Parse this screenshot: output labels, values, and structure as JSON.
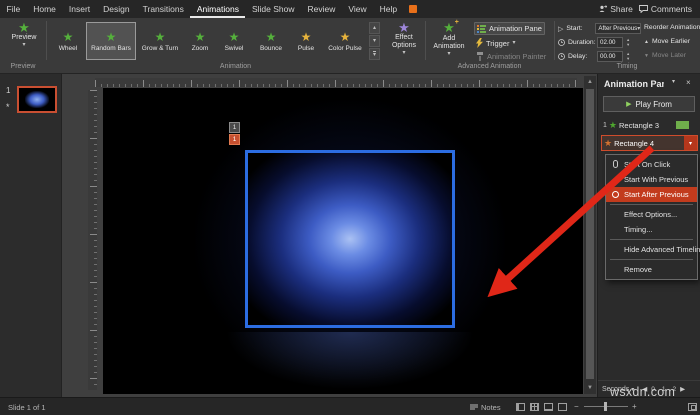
{
  "menubar": {
    "items": [
      {
        "label": "File"
      },
      {
        "label": "Home"
      },
      {
        "label": "Insert"
      },
      {
        "label": "Design"
      },
      {
        "label": "Transitions"
      },
      {
        "label": "Animations"
      },
      {
        "label": "Slide Show"
      },
      {
        "label": "Review"
      },
      {
        "label": "View"
      },
      {
        "label": "Help"
      }
    ],
    "share_label": "Share",
    "comments_label": "Comments"
  },
  "ribbon": {
    "preview_label": "Preview",
    "gallery": [
      {
        "label": "Wheel"
      },
      {
        "label": "Random Bars"
      },
      {
        "label": "Grow & Turn"
      },
      {
        "label": "Zoom"
      },
      {
        "label": "Swivel"
      },
      {
        "label": "Bounce"
      },
      {
        "label": "Pulse"
      },
      {
        "label": "Color Pulse"
      }
    ],
    "effect_options_label": "Effect Options",
    "add_animation_label": "Add Animation",
    "animation_pane_label": "Animation Pane",
    "trigger_label": "Trigger",
    "animation_painter_label": "Animation Painter",
    "start_label": "Start:",
    "start_value": "After Previous",
    "duration_label": "Duration:",
    "duration_value": "02.00",
    "delay_label": "Delay:",
    "delay_value": "00.00",
    "reorder_title": "Reorder Animation",
    "move_earlier_label": "Move Earlier",
    "move_later_label": "Move Later",
    "group_labels": [
      "Preview",
      "Animation",
      "Advanced Animation",
      "Timing"
    ]
  },
  "thumbnails": {
    "number": "1",
    "indicator": "*"
  },
  "slide": {
    "tags": [
      "1",
      "1"
    ]
  },
  "animation_pane": {
    "title": "Animation Pane",
    "play_from_label": "Play From",
    "items": [
      {
        "num": "1",
        "label": "Rectangle 3"
      },
      {
        "num": "",
        "label": "Rectangle 4"
      }
    ],
    "menu_items": [
      {
        "label": "Start On Click"
      },
      {
        "label": "Start With Previous"
      },
      {
        "label": "Start After Previous"
      },
      {
        "label": "Effect Options..."
      },
      {
        "label": "Timing..."
      },
      {
        "label": "Hide Advanced Timeline"
      },
      {
        "label": "Remove"
      }
    ],
    "seconds_label": "Seconds",
    "ticks": [
      "0",
      "1",
      "2"
    ]
  },
  "statusbar": {
    "slide_label": "Slide 1 of 1",
    "notes_label": "Notes"
  },
  "watermark": "wsxdn.com"
}
